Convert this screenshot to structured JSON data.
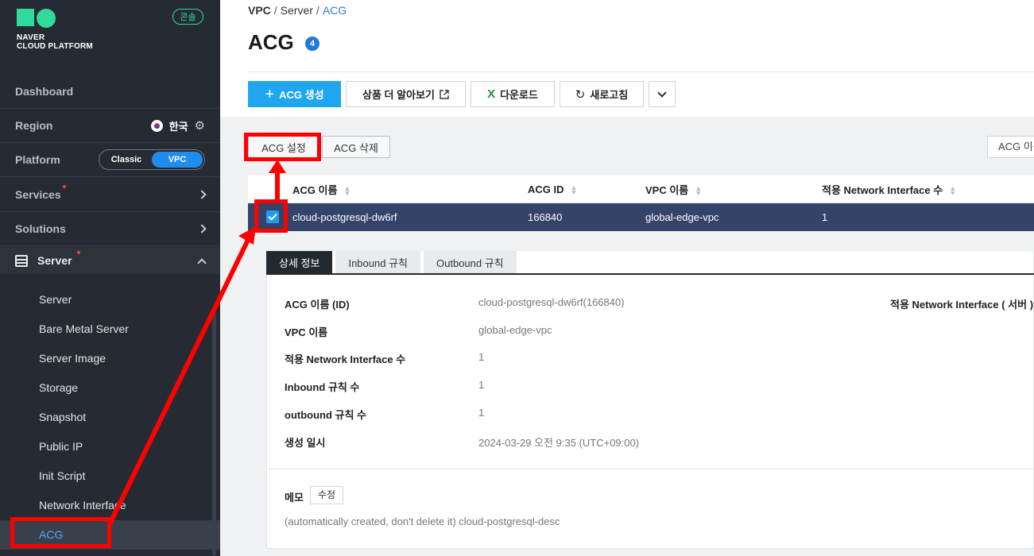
{
  "brand": {
    "logo_line1": "NAVER",
    "logo_line2": "CLOUD PLATFORM",
    "console_label": "콘솔"
  },
  "sidebar": {
    "dashboard": "Dashboard",
    "region_label": "Region",
    "region_value": "한국",
    "platform_label": "Platform",
    "platform_options": [
      "Classic",
      "VPC"
    ],
    "platform_selected": "VPC",
    "services": "Services",
    "solutions": "Solutions",
    "server": "Server",
    "submenu": [
      "Server",
      "Bare Metal Server",
      "Server Image",
      "Storage",
      "Snapshot",
      "Public IP",
      "Init Script",
      "Network Interface",
      "ACG"
    ],
    "submenu_active": "ACG"
  },
  "breadcrumb": [
    "VPC",
    "Server",
    "ACG"
  ],
  "page": {
    "title": "ACG",
    "count": "4"
  },
  "toolbar": {
    "create": "ACG 생성",
    "learn_more": "상품 더 알아보기",
    "download": "다운로드",
    "refresh": "새로고침"
  },
  "actions": {
    "settings": "ACG 설정",
    "delete": "ACG 삭제",
    "filter_placeholder": "ACG 이름"
  },
  "table": {
    "columns": [
      "ACG 이름",
      "ACG ID",
      "VPC 이름",
      "적용 Network Interface 수"
    ],
    "rows": [
      [
        "cloud-postgresql-dw6rf",
        "166840",
        "global-edge-vpc",
        "1"
      ]
    ]
  },
  "detail": {
    "tabs": [
      "상세 정보",
      "Inbound 규칙",
      "Outbound 규칙"
    ],
    "active_tab": "상세 정보",
    "fields": [
      {
        "label": "ACG 이름 (ID)",
        "value": "cloud-postgresql-dw6rf(166840)"
      },
      {
        "label": "VPC 이름",
        "value": "global-edge-vpc"
      },
      {
        "label": "적용 Network Interface 수",
        "value": "1"
      },
      {
        "label": "Inbound 규칙 수",
        "value": "1"
      },
      {
        "label": "outbound 규칙 수",
        "value": "1"
      },
      {
        "label": "생성 일시",
        "value": "2024-03-29 오전 9:35 (UTC+09:00)"
      }
    ],
    "right_label": "적용 Network Interface ( 서버 )",
    "memo_label": "메모",
    "memo_edit": "수정",
    "memo_text": "(automatically created, don't delete it) cloud-postgresql-desc"
  },
  "colors": {
    "sidebar_bg": "#262b33",
    "accent_green": "#2edb9c",
    "primary_blue": "#1fa6ee",
    "selected_row": "#344469",
    "annotation_red": "#ff0000"
  }
}
